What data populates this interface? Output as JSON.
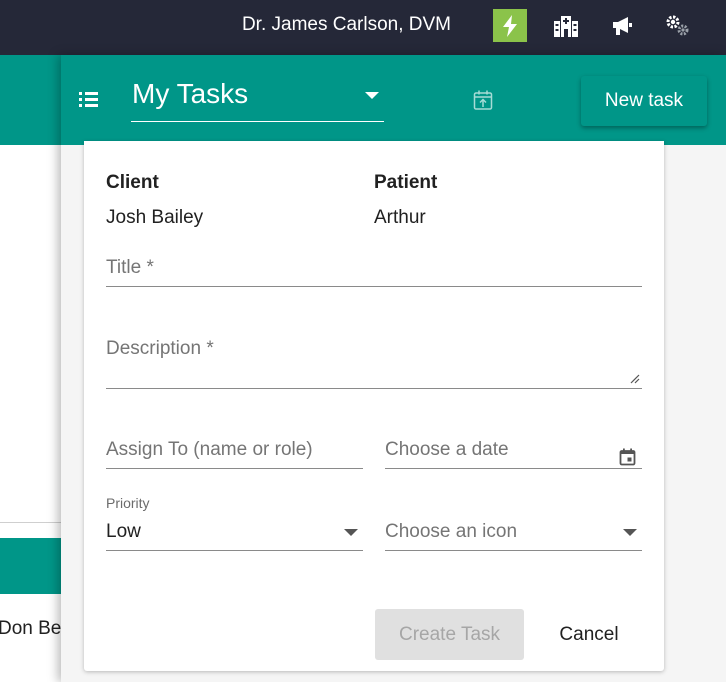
{
  "topbar": {
    "user_name": "Dr. James Carlson, DVM",
    "icons": [
      "lightning-icon",
      "hospital-icon",
      "megaphone-icon",
      "settings-icon"
    ],
    "active_icon_color": "#8bc34a",
    "background_color": "#252838"
  },
  "background": {
    "visible_text": "Don Ben"
  },
  "panel": {
    "task_list_selected": "My Tasks",
    "new_task_label": "New task",
    "accent_color": "#009688"
  },
  "form": {
    "client_label": "Client",
    "client_value": "Josh Bailey",
    "patient_label": "Patient",
    "patient_value": "Arthur",
    "title_placeholder": "Title *",
    "description_placeholder": "Description *",
    "assign_placeholder": "Assign To (name or role)",
    "date_placeholder": "Choose a date",
    "priority_label": "Priority",
    "priority_value": "Low",
    "icon_placeholder": "Choose an icon",
    "create_label": "Create Task",
    "cancel_label": "Cancel"
  }
}
